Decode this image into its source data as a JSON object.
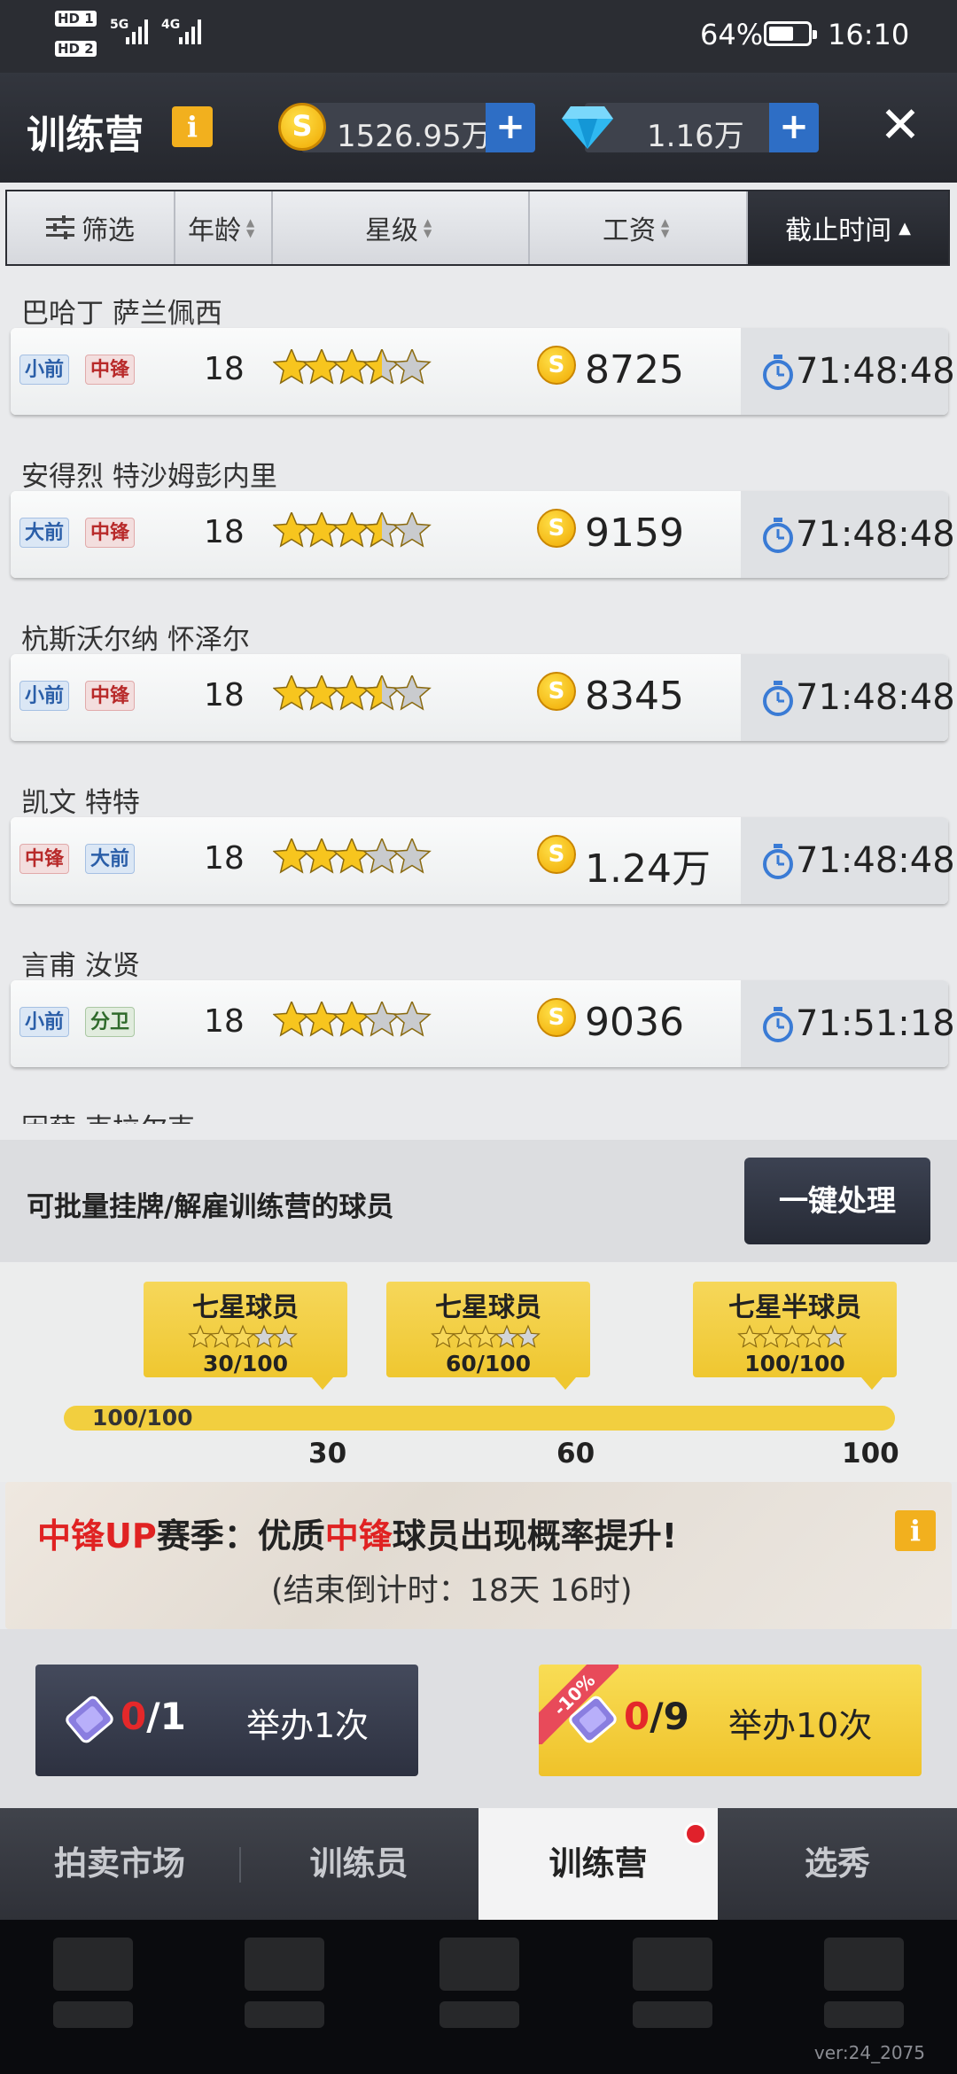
{
  "status_bar": {
    "hd1": "HD 1",
    "hd2": "HD 2",
    "net1": "5G",
    "net2": "4G",
    "battery_percent": "64%",
    "battery_level": 0.64,
    "time": "16:10"
  },
  "header": {
    "title": "训练营",
    "info_icon": "i",
    "coins": "1526.95万",
    "gems": "1.16万",
    "plus": "+",
    "close": "✕"
  },
  "filter_bar": {
    "filter_label": "筛选",
    "age_label": "年龄",
    "stars_label": "星级",
    "salary_label": "工资",
    "deadline_label": "截止时间"
  },
  "players": [
    {
      "name": "巴哈丁 萨兰佩西",
      "tags": [
        {
          "text": "小前",
          "color": "blue"
        },
        {
          "text": "中锋",
          "color": "red"
        }
      ],
      "age": "18",
      "stars": 3.5,
      "wage": "8725",
      "deadline": "71:48:48"
    },
    {
      "name": "安得烈 特沙姆彭内里",
      "tags": [
        {
          "text": "大前",
          "color": "blue"
        },
        {
          "text": "中锋",
          "color": "red"
        }
      ],
      "age": "18",
      "stars": 3.5,
      "wage": "9159",
      "deadline": "71:48:48"
    },
    {
      "name": "杭斯沃尔纳 怀泽尔",
      "tags": [
        {
          "text": "小前",
          "color": "blue"
        },
        {
          "text": "中锋",
          "color": "red"
        }
      ],
      "age": "18",
      "stars": 3.5,
      "wage": "8345",
      "deadline": "71:48:48"
    },
    {
      "name": "凯文 特特",
      "tags": [
        {
          "text": "中锋",
          "color": "red"
        },
        {
          "text": "大前",
          "color": "blue"
        }
      ],
      "age": "18",
      "stars": 3,
      "wage": "1.24万",
      "deadline": "71:48:48"
    },
    {
      "name": "言甫 汝贤",
      "tags": [
        {
          "text": "小前",
          "color": "blue"
        },
        {
          "text": "分卫",
          "color": "green"
        }
      ],
      "age": "18",
      "stars": 3,
      "wage": "9036",
      "deadline": "71:51:18"
    },
    {
      "name": "因薛 克拉尔克"
    }
  ],
  "batch": {
    "text": "可批量挂牌/解雇训练营的球员",
    "button": "一键处理"
  },
  "milestones": {
    "items": [
      {
        "title": "七星球员",
        "count": "30/100",
        "stars": 7
      },
      {
        "title": "七星球员",
        "count": "60/100",
        "stars": 7
      },
      {
        "title": "七星半球员",
        "count": "100/100",
        "stars": 7.5
      }
    ],
    "progress_label": "100/100",
    "progress": 1.0,
    "marks": [
      "30",
      "60",
      "100"
    ]
  },
  "season": {
    "part1": "中锋UP",
    "part2": "赛季：优质",
    "part3": "中锋",
    "part4": "球员出现概率提升!",
    "countdown": "(结束倒计时：18天 16时)"
  },
  "actions": {
    "single": {
      "zero": "0",
      "rest": "/1",
      "label": "举办1次"
    },
    "ten": {
      "zero": "0",
      "rest": "/9",
      "label": "举办10次",
      "discount": "-10%"
    }
  },
  "tabs": [
    "拍卖市场",
    "训练员",
    "训练营",
    "选秀"
  ],
  "version": "ver:24_2075",
  "colors": {
    "accent_gold": "#f2c936",
    "accent_blue": "#2e6ec5",
    "highlight_red": "#e02222"
  }
}
